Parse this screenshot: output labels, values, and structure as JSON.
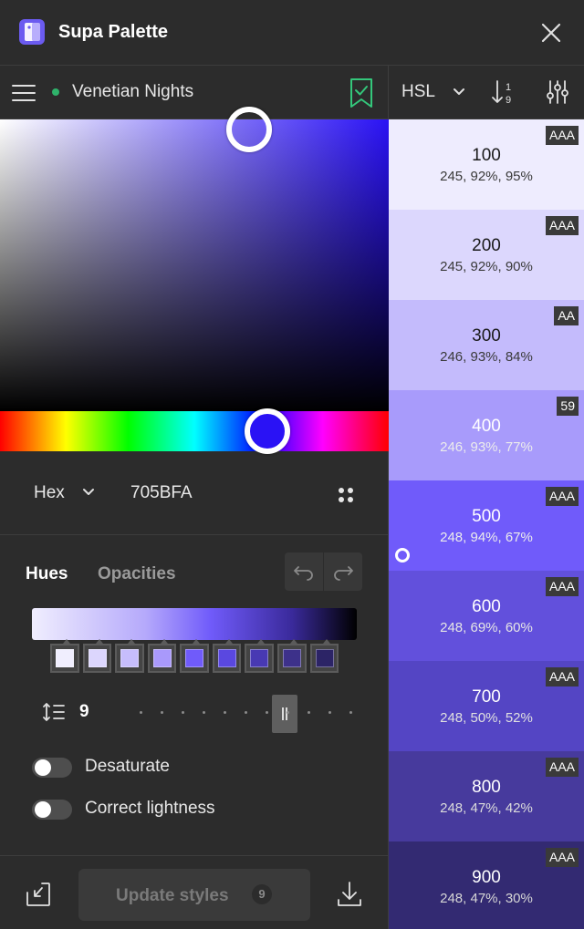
{
  "app": {
    "title": "Supa Palette"
  },
  "toolbar": {
    "palette_name": "Venetian Nights",
    "color_format": "HSL"
  },
  "picker": {
    "mode": "Hex",
    "hex_value": "705BFA",
    "hue_color": "#2a12f5"
  },
  "generator": {
    "tabs": [
      "Hues",
      "Opacities"
    ],
    "active_tab": "Hues",
    "steps": "9",
    "step_slider_fraction": 0.7,
    "swatches": [
      "#f0eefe",
      "#dcd6fd",
      "#c6bdfc",
      "#a999fb",
      "#705bfa",
      "#5a48e0",
      "#4839b3",
      "#3d318a",
      "#2c2466"
    ],
    "desaturate_label": "Desaturate",
    "desaturate_on": false,
    "correct_lightness_label": "Correct lightness",
    "correct_lightness_on": false
  },
  "actions": {
    "update_label": "Update styles",
    "update_count": "9"
  },
  "shades": [
    {
      "name": "100",
      "values": "245, 92%, 95%",
      "badge": "AAA",
      "bg": "#eeecfe",
      "fg": "#1a1a1a",
      "sub": "#3a3a3a"
    },
    {
      "name": "200",
      "values": "245, 92%, 90%",
      "badge": "AAA",
      "bg": "#dcd7fd",
      "fg": "#1a1a1a",
      "sub": "#3a3a3a"
    },
    {
      "name": "300",
      "values": "246, 93%, 84%",
      "badge": "AA",
      "bg": "#c4bbfc",
      "fg": "#1a1a1a",
      "sub": "#3a3a3a"
    },
    {
      "name": "400",
      "values": "246, 93%, 77%",
      "badge": "59",
      "bg": "#a89bfb",
      "fg": "#ffffff",
      "sub": "#ececec"
    },
    {
      "name": "500",
      "values": "248, 94%, 67%",
      "badge": "AAA",
      "bg": "#705bfa",
      "fg": "#ffffff",
      "sub": "#ececec",
      "selected": true
    },
    {
      "name": "600",
      "values": "248, 69%, 60%",
      "badge": "AAA",
      "bg": "#6250dc",
      "fg": "#ffffff",
      "sub": "#e6e6e6"
    },
    {
      "name": "700",
      "values": "248, 50%, 52%",
      "badge": "AAA",
      "bg": "#5445c4",
      "fg": "#ffffff",
      "sub": "#e0e0e0"
    },
    {
      "name": "800",
      "values": "248, 47%, 42%",
      "badge": "AAA",
      "bg": "#473a9d",
      "fg": "#ffffff",
      "sub": "#dcdcdc"
    },
    {
      "name": "900",
      "values": "248, 47%, 30%",
      "badge": "AAA",
      "bg": "#332a72",
      "fg": "#ffffff",
      "sub": "#d6d6d6"
    }
  ]
}
